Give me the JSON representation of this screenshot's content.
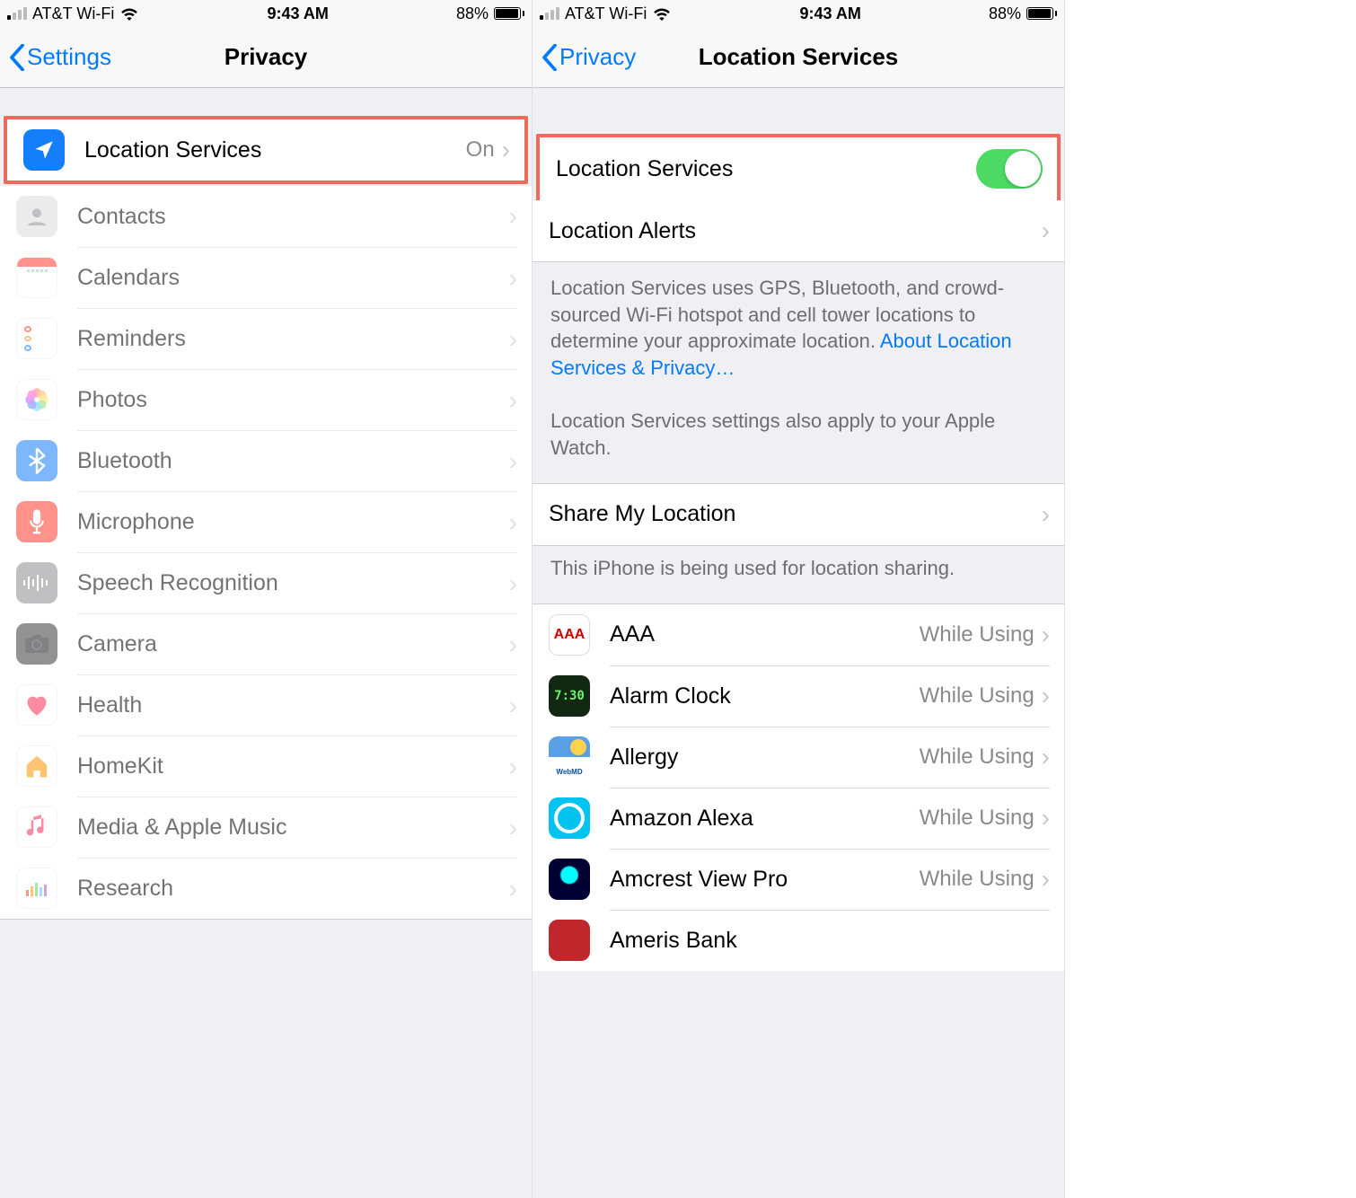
{
  "status": {
    "carrier": "AT&T Wi-Fi",
    "time": "9:43 AM",
    "battery_pct": "88%"
  },
  "left": {
    "back_label": "Settings",
    "title": "Privacy",
    "rows": [
      {
        "label": "Location Services",
        "value": "On"
      },
      {
        "label": "Contacts"
      },
      {
        "label": "Calendars"
      },
      {
        "label": "Reminders"
      },
      {
        "label": "Photos"
      },
      {
        "label": "Bluetooth"
      },
      {
        "label": "Microphone"
      },
      {
        "label": "Speech Recognition"
      },
      {
        "label": "Camera"
      },
      {
        "label": "Health"
      },
      {
        "label": "HomeKit"
      },
      {
        "label": "Media & Apple Music"
      },
      {
        "label": "Research"
      }
    ]
  },
  "right": {
    "back_label": "Privacy",
    "title": "Location Services",
    "toggle_label": "Location Services",
    "toggle_state": "on",
    "alerts_label": "Location Alerts",
    "desc_main": "Location Services uses GPS, Bluetooth, and crowd-sourced Wi-Fi hotspot and cell tower locations to determine your approximate location. ",
    "desc_link": "About Location Services & Privacy…",
    "desc_secondary": "Location Services settings also apply to your Apple Watch.",
    "share_label": "Share My Location",
    "share_footer": "This iPhone is being used for location sharing.",
    "apps": [
      {
        "label": "AAA",
        "value": "While Using"
      },
      {
        "label": "Alarm Clock",
        "value": "While Using"
      },
      {
        "label": "Allergy",
        "value": "While Using"
      },
      {
        "label": "Amazon Alexa",
        "value": "While Using"
      },
      {
        "label": "Amcrest View Pro",
        "value": "While Using"
      },
      {
        "label": "Ameris Bank",
        "value": ""
      }
    ]
  }
}
